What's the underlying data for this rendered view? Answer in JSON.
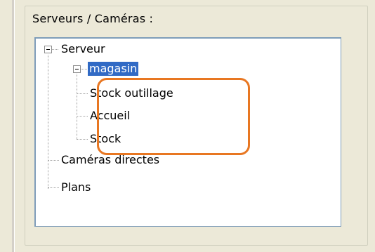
{
  "group": {
    "label": "Serveurs / Caméras :"
  },
  "tree": {
    "root": {
      "label": "Serveur",
      "expanded": true
    },
    "server": {
      "label": "magasin",
      "expanded": true,
      "selected": true
    },
    "cameras": [
      {
        "label": "Stock outillage"
      },
      {
        "label": "Accueil"
      },
      {
        "label": "Stock"
      }
    ],
    "root_children": [
      {
        "label": "Caméras directes"
      },
      {
        "label": "Plans"
      }
    ]
  },
  "colors": {
    "selection": "#316AC5",
    "highlight": "#E87722"
  }
}
